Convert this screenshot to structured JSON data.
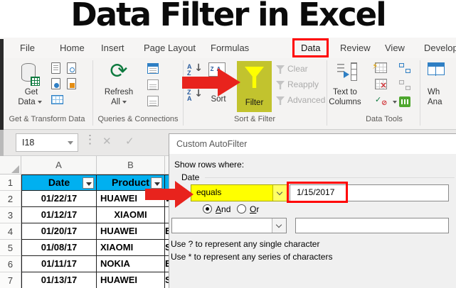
{
  "title": "Data Filter in Excel",
  "ribbon": {
    "tabs": [
      "File",
      "Home",
      "Insert",
      "Page Layout",
      "Formulas",
      "Data",
      "Review",
      "View",
      "Developer"
    ],
    "active_tab": "Data",
    "get_data": {
      "line1": "Get",
      "line2": "Data"
    },
    "refresh": {
      "line1": "Refresh",
      "line2": "All"
    },
    "sort_label": "Sort",
    "filter_label": "Filter",
    "clear_label": "Clear",
    "reapply_label": "Reapply",
    "advanced_label": "Advanced",
    "text_to_columns": {
      "line1": "Text to",
      "line2": "Columns"
    },
    "what_if": {
      "line1": "Wh",
      "line2": "Ana"
    },
    "group_labels": [
      "Get & Transform Data",
      "Queries & Connections",
      "Sort & Filter",
      "Data Tools"
    ]
  },
  "formula_bar": {
    "name_box": "I18"
  },
  "sheet": {
    "col_headers": [
      "A",
      "B"
    ],
    "row1": {
      "num": "1",
      "date_header": "Date",
      "product_header": "Product"
    },
    "rows": [
      {
        "num": "2",
        "date": "01/22/17",
        "product": "HUAWEI",
        "c_partial": "W"
      },
      {
        "num": "3",
        "date": "01/12/17",
        "product": "XIAOMI",
        "c_partial": ""
      },
      {
        "num": "4",
        "date": "01/20/17",
        "product": "HUAWEI",
        "c_partial": "E"
      },
      {
        "num": "5",
        "date": "01/08/17",
        "product": "XIAOMI",
        "c_partial": "S"
      },
      {
        "num": "6",
        "date": "01/11/17",
        "product": "NOKIA",
        "c_partial": "E"
      },
      {
        "num": "7",
        "date": "01/13/17",
        "product": "HUAWEI",
        "c_partial": "S"
      }
    ]
  },
  "dialog": {
    "title": "Custom AutoFilter",
    "show_rows_label": "Show rows where:",
    "field_label": "Date",
    "condition1": "equals",
    "value1": "1/15/2017",
    "and_label": "And",
    "or_label": "Or",
    "selected_radio": "And",
    "condition2": "",
    "value2": "",
    "hint_single": "Use ? to represent any single character",
    "hint_series": "Use * to represent any series of characters"
  },
  "colors": {
    "table_header_fill": "#00b0f0",
    "highlight_yellow": "#ffff00",
    "filter_button_fill": "#c2c32e",
    "annotation_red": "#e8231d",
    "red_box": "#ff0000"
  }
}
